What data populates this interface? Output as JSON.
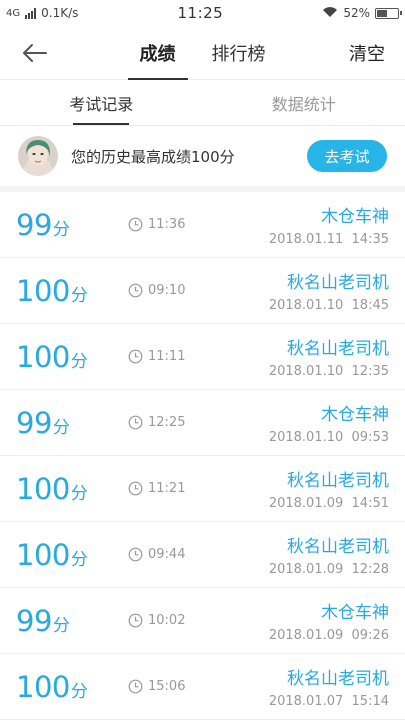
{
  "status_bar": {
    "network": "4G",
    "speed": "0.1K/s",
    "time": "11:25",
    "battery": "52%",
    "battery_level": 0.52
  },
  "nav": {
    "tabs": [
      {
        "label": "成绩",
        "active": true
      },
      {
        "label": "排行榜",
        "active": false
      }
    ],
    "clear_label": "清空"
  },
  "sub_tabs": [
    {
      "label": "考试记录",
      "active": true
    },
    {
      "label": "数据统计",
      "active": false
    }
  ],
  "best": {
    "text": "您的历史最高成绩100分",
    "button_label": "去考试"
  },
  "colors": {
    "accent": "#27a9e1",
    "button": "#27b4e6"
  },
  "records": [
    {
      "score": "99",
      "unit": "分",
      "duration": "11:36",
      "name": "木仓车神",
      "date": "2018.01.11  14:35"
    },
    {
      "score": "100",
      "unit": "分",
      "duration": "09:10",
      "name": "秋名山老司机",
      "date": "2018.01.10  18:45"
    },
    {
      "score": "100",
      "unit": "分",
      "duration": "11:11",
      "name": "秋名山老司机",
      "date": "2018.01.10  12:35"
    },
    {
      "score": "99",
      "unit": "分",
      "duration": "12:25",
      "name": "木仓车神",
      "date": "2018.01.10  09:53"
    },
    {
      "score": "100",
      "unit": "分",
      "duration": "11:21",
      "name": "秋名山老司机",
      "date": "2018.01.09  14:51"
    },
    {
      "score": "100",
      "unit": "分",
      "duration": "09:44",
      "name": "秋名山老司机",
      "date": "2018.01.09  12:28"
    },
    {
      "score": "99",
      "unit": "分",
      "duration": "10:02",
      "name": "木仓车神",
      "date": "2018.01.09  09:26"
    },
    {
      "score": "100",
      "unit": "分",
      "duration": "15:06",
      "name": "秋名山老司机",
      "date": "2018.01.07  15:14"
    }
  ]
}
